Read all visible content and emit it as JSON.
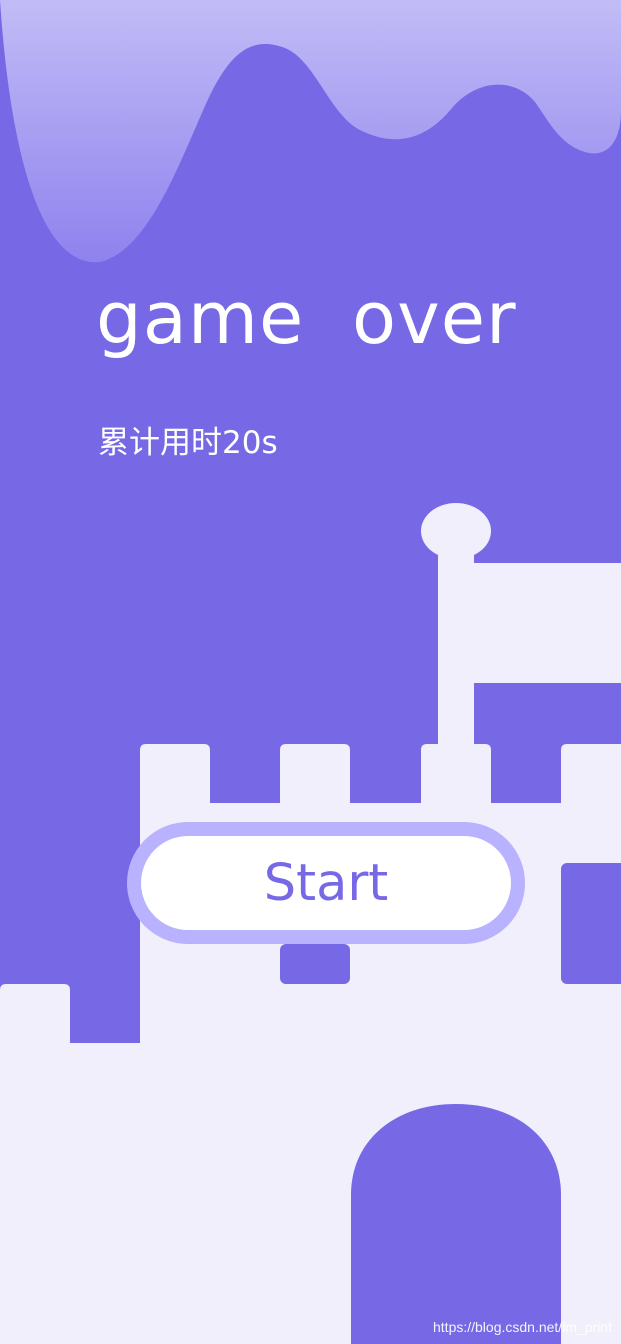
{
  "game": {
    "title": "game  over",
    "elapsed": "累计用时20s",
    "start_label": "Start"
  },
  "watermark": "https://blog.csdn.net/lm_print",
  "colors": {
    "background": "#7769e6",
    "castle": "#f1effb",
    "button_border": "#b8b2ff",
    "button_fill": "#ffffff",
    "accent": "#7769e6"
  }
}
